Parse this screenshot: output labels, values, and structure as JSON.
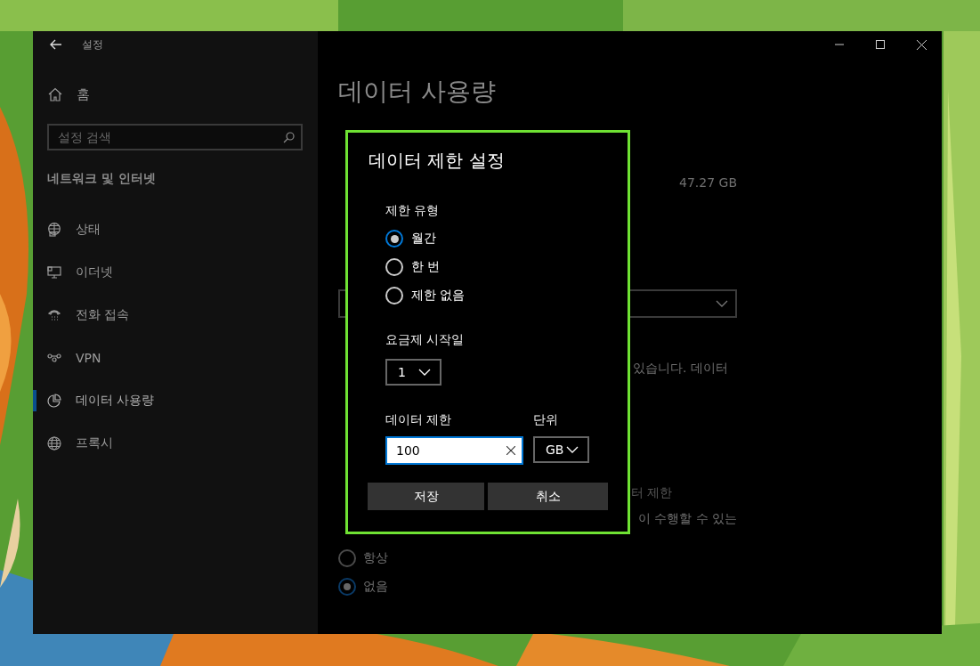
{
  "window": {
    "title": "설정"
  },
  "sidebar": {
    "home": "홈",
    "search": {
      "placeholder": "설정 검색"
    },
    "section": "네트워크 및 인터넷",
    "items": [
      {
        "label": "상태",
        "kind": "status",
        "selected": false
      },
      {
        "label": "이더넷",
        "kind": "ethernet",
        "selected": false
      },
      {
        "label": "전화 접속",
        "kind": "dialup",
        "selected": false
      },
      {
        "label": "VPN",
        "kind": "vpn",
        "selected": false
      },
      {
        "label": "데이터 사용량",
        "kind": "data",
        "selected": true
      },
      {
        "label": "프록시",
        "kind": "proxy",
        "selected": false
      }
    ]
  },
  "main": {
    "title": "데이터 사용량",
    "usage_total": "47.27 GB",
    "text_fragment_1": "있습니다. 데이터",
    "link_fragment": "터 제한",
    "text_fragment_2": "이 수행할 수 있는",
    "restriction_options": [
      {
        "label": "항상",
        "selected": false
      },
      {
        "label": "없음",
        "selected": true
      }
    ]
  },
  "dialog": {
    "title": "데이터 제한 설정",
    "limit_type_label": "제한 유형",
    "limit_types": [
      {
        "label": "월간",
        "selected": true
      },
      {
        "label": "한 번",
        "selected": false
      },
      {
        "label": "제한 없음",
        "selected": false
      }
    ],
    "start_day_label": "요금제 시작일",
    "start_day": "1",
    "data_limit_label": "데이터 제한",
    "data_limit": "100",
    "unit_label": "단위",
    "unit": "GB",
    "buttons": [
      "저장",
      "취소"
    ]
  }
}
